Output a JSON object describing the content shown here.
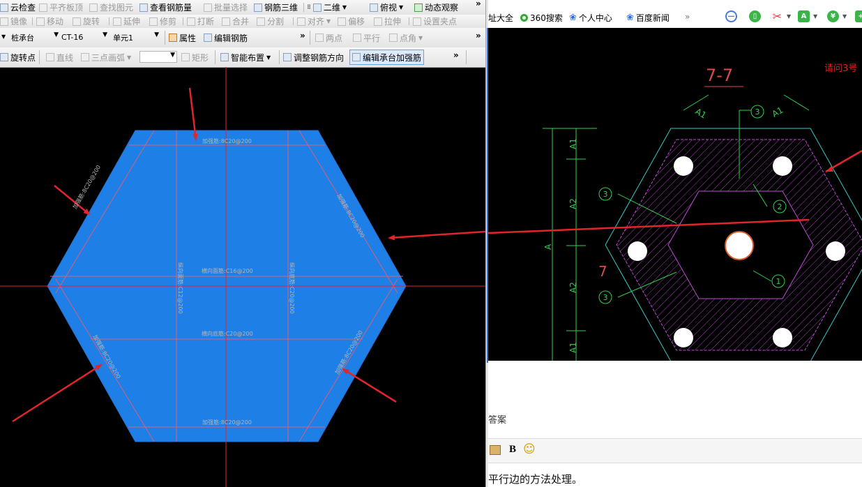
{
  "left_app": {
    "toolbar_row1": {
      "cloud_check": "云检查",
      "flush_slab_top": "平齐板顶",
      "find_element": "查找图元",
      "view_rebar_qty": "查看钢筋量",
      "batch_select": "批量选择",
      "rebar_3d": "钢筋三维",
      "view_2d": "二维",
      "top_view": "俯视",
      "dynamic_observe": "动态观察"
    },
    "toolbar_row2": {
      "mirror": "镜像",
      "move": "移动",
      "rotate": "旋转",
      "extend": "延伸",
      "trim": "修剪",
      "break": "打断",
      "merge": "合并",
      "split": "分割",
      "align": "对齐",
      "offset": "偏移",
      "stretch": "拉伸",
      "set_pinch_point": "设置夹点"
    },
    "toolbar_row3": {
      "category_select": "桩承台",
      "element_select": "CT-16",
      "unit_select": "单元1",
      "properties": "属性",
      "edit_rebar": "编辑钢筋",
      "two_points": "两点",
      "parallel": "平行",
      "point_angle": "点角"
    },
    "toolbar_row4": {
      "rotate_point": "旋转点",
      "line": "直线",
      "three_point_arc": "三点画弧",
      "rectangle": "矩形",
      "smart_layout": "智能布置",
      "adjust_rebar_direction": "调整钢筋方向",
      "edit_cap_strengthen_rebar": "编辑承台加强筋"
    },
    "canvas": {
      "hex_fill": "#1e7fe6",
      "rebar_line_color": "#d9607a",
      "axis_color": "#e0252b",
      "arrow_color": "#e0252b",
      "labels": {
        "top_strengthen": "加强筋:8C20@200",
        "bottom_strengthen": "加强筋:8C20@200",
        "upper_left_strengthen": "加强筋:8C20@200",
        "upper_right_strengthen": "加强筋:8C20@200",
        "lower_left_strengthen": "加强筋:8C20@200",
        "lower_right_strengthen": "加强筋:8C20@200",
        "horizontal_top_rebar": "横向面筋:C16@200",
        "horizontal_bottom_rebar": "横向底筋:C20@200",
        "vertical_top_rebar": "纵向面筋:C12@200",
        "vertical_bottom_rebar": "纵向底筋:C20@200"
      }
    }
  },
  "browser": {
    "bookmarks": {
      "site_nav": "址大全",
      "search_360": "360搜索",
      "personal_center": "个人中心",
      "baidu_news": "百度新闻",
      "more": "»"
    },
    "cad_image": {
      "section_title": "7-7",
      "question_text": "请问3号",
      "section_mark": "7",
      "dim_A1": "A1",
      "dim_A2": "A2",
      "dim_A": "A",
      "callout_1": "1",
      "callout_2": "2",
      "callout_3": "3"
    },
    "answer_label": "答案",
    "editor": {
      "bold": "B",
      "emoji": "☺"
    },
    "answer_text": "平行边的方法处理。"
  }
}
